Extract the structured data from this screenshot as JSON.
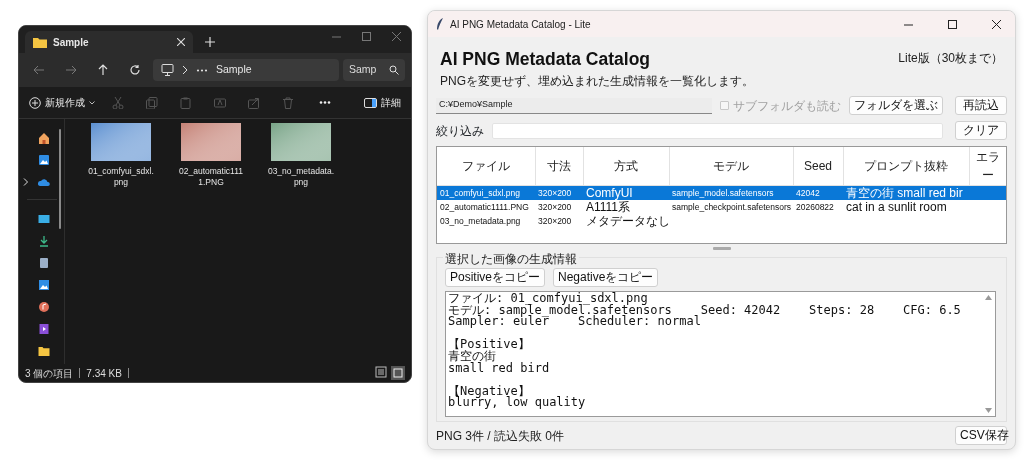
{
  "explorer": {
    "tab": {
      "title": "Sample"
    },
    "address": {
      "location": "Sample"
    },
    "search": {
      "value": "Samp"
    },
    "commands": {
      "new": "新規作成",
      "details": "詳細"
    },
    "sidebar": [
      {
        "expandable": false
      },
      {
        "expandable": false
      },
      {
        "expandable": true
      },
      {
        "expandable": false
      },
      {
        "expandable": false
      },
      {
        "expandable": false
      },
      {
        "expandable": false
      },
      {
        "expandable": false
      },
      {
        "expandable": false
      },
      {
        "expandable": false
      }
    ],
    "files": [
      {
        "name_lines": [
          "01_comfyui_sdxl.",
          "png"
        ],
        "color": "#5b8fd0"
      },
      {
        "name_lines": [
          "02_automatic111",
          "1.PNG"
        ],
        "color": "#c48074"
      },
      {
        "name_lines": [
          "03_no_metadata.",
          "png"
        ],
        "color": "#77a386"
      }
    ],
    "status_bar": {
      "count": "3 個の項目",
      "size": "7.34 KB"
    }
  },
  "app": {
    "window": {
      "title": "AI PNG Metadata Catalog - Lite"
    },
    "heading": "AI PNG Metadata Catalog",
    "edition": "Lite版（30枚まで）",
    "subtitle": "PNGを変更せず、埋め込まれた生成情報を一覧化します。",
    "path": {
      "value": "C:¥Demo¥Sample"
    },
    "subfolders": {
      "label": "サブフォルダも読む",
      "checked": false,
      "disabled": true
    },
    "buttons": [
      "フォルダを選ぶ",
      "再読込"
    ],
    "filter": {
      "label": "絞り込み",
      "button": "クリア"
    },
    "table": {
      "columns": [
        "ファイル",
        "寸法",
        "方式",
        "モデル",
        "Seed",
        "プロンプト抜粋",
        "エラー"
      ],
      "rows": [
        {
          "selected": true,
          "cells": [
            "01_comfyui_sdxl.png",
            "320×200",
            "ComfyUI",
            "sample_model.safetensors",
            "42042",
            "青空の街 small red bir"
          ]
        },
        {
          "selected": false,
          "cells": [
            "02_automatic1111.PNG",
            "320×200",
            "A1111系",
            "sample_checkpoint.safetensors",
            "20260822",
            "cat in a sunlit room"
          ]
        },
        {
          "selected": false,
          "cells": [
            "03_no_metadata.png",
            "320×200",
            "メタデータなし"
          ]
        }
      ]
    },
    "details": {
      "label": "選択した画像の生成情報",
      "buttons": [
        "Positiveをコピー",
        "Negativeをコピー"
      ],
      "blocks": [
        [
          "ファイル: 01_comfyui_sdxl.png",
          "モデル: sample_model.safetensors    Seed: 42042    Steps: 28    CFG: 6.5",
          "Sampler: euler    Scheduler: normal"
        ],
        [
          "【Positive】",
          "青空の街",
          "small red bird"
        ],
        [
          "【Negative】",
          "blurry, low quality"
        ]
      ]
    },
    "status_bar": {
      "summary": "PNG 3件 / 読込失敗 0件",
      "button": "CSV保存"
    }
  }
}
